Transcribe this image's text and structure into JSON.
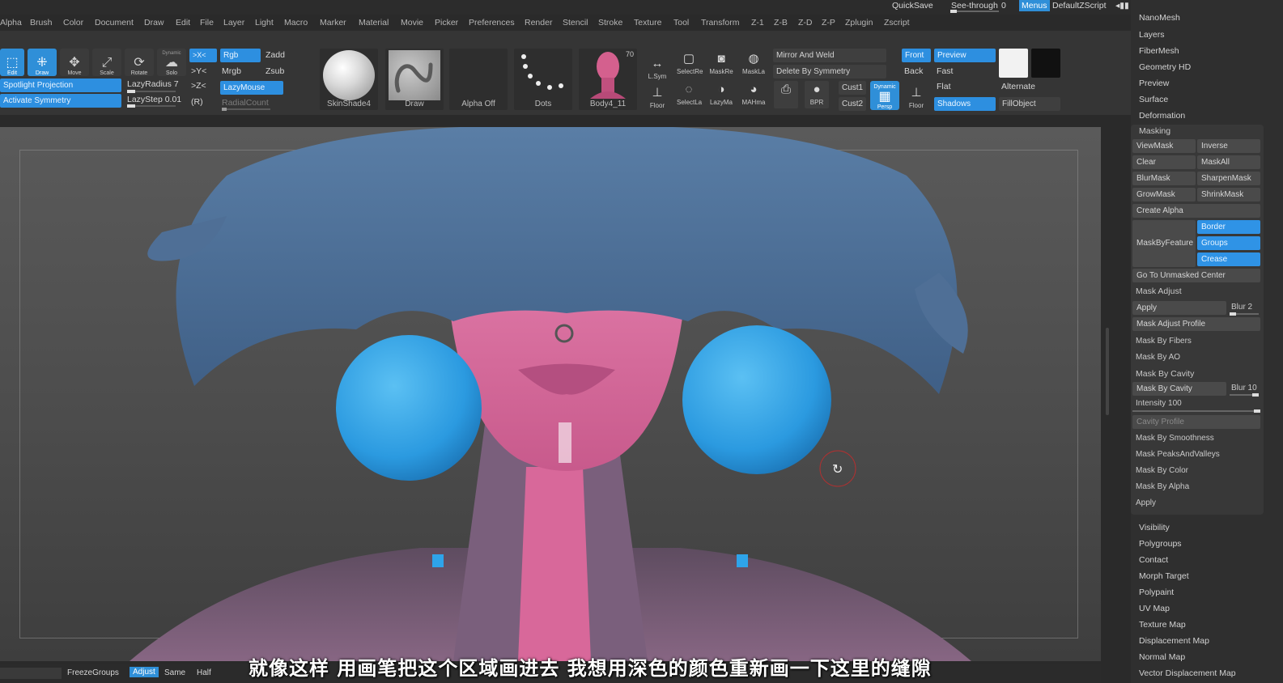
{
  "menubar": {
    "items": [
      "Alpha",
      "Brush",
      "Color",
      "Document",
      "Draw",
      "Edit",
      "File",
      "Layer",
      "Light",
      "Macro",
      "Marker",
      "Material",
      "Movie",
      "Picker",
      "Preferences",
      "Render",
      "Stencil",
      "Stroke",
      "Texture",
      "Tool",
      "Transform",
      "Z-1",
      "Z-B",
      "Z-D",
      "Z-P",
      "Zplugin",
      "Zscript"
    ],
    "quicksave": "QuickSave",
    "see_through_label": "See-through",
    "see_through_value": "0",
    "menus_label": "Menus",
    "default_script": "DefaultZScript"
  },
  "shelf": {
    "edit": "Edit",
    "draw": "Draw",
    "move": "Move",
    "scale": "Scale",
    "rotate": "Rotate",
    "dynamic": "Dynamic",
    "solo": "Solo",
    "spotlight": "Spotlight Projection",
    "activate_symmetry": "Activate Symmetry",
    "lazy_radius": "LazyRadius 7",
    "lazy_step": "LazyStep 0.01",
    "x_axis": ">X<",
    "y_axis": ">Y<",
    "z_axis": ">Z<",
    "r_axis": "(R)",
    "rgb": "Rgb",
    "mrgb": "Mrgb",
    "lazymouse": "LazyMouse",
    "radialcount": "RadialCount",
    "zadd": "Zadd",
    "zsub": "Zsub",
    "material": "SkinShade4",
    "brush": "Draw",
    "alpha": "Alpha Off",
    "stroke": "Dots",
    "tool": "Body4_11",
    "tool_count": "70",
    "lsym": "L.Sym",
    "floor": "Floor",
    "select_rect": "SelectRe",
    "mask_rect": "MaskRe",
    "mask_lasso": "MaskLa",
    "select_lasso": "SelectLa",
    "lazy_mask": "LazyMa",
    "mah_mask": "MAHma",
    "bpr": "BPR",
    "mirror_weld": "Mirror And Weld",
    "delete_symmetry": "Delete By Symmetry",
    "cust1": "Cust1",
    "cust2": "Cust2",
    "dynamic_persp": "Dynamic",
    "persp": "Persp",
    "front": "Front",
    "back": "Back",
    "floor2": "Floor",
    "preview": "Preview",
    "fast": "Fast",
    "flat": "Flat",
    "shadows": "Shadows",
    "alternate": "Alternate",
    "fillobject": "FillObject"
  },
  "palette": {
    "items_top": [
      "NanoMesh",
      "Layers",
      "FiberMesh",
      "Geometry HD",
      "Preview",
      "Surface",
      "Deformation"
    ],
    "masking_title": "Masking",
    "viewmask": "ViewMask",
    "inverse": "Inverse",
    "clear": "Clear",
    "maskall": "MaskAll",
    "blurmask": "BlurMask",
    "sharpenmask": "SharpenMask",
    "growmask": "GrowMask",
    "shrinkmask": "ShrinkMask",
    "create_alpha": "Create Alpha",
    "mask_by_feature": "MaskByFeature",
    "border": "Border",
    "groups": "Groups",
    "crease": "Crease",
    "go_unmasked": "Go To Unmasked Center",
    "mask_adjust": "Mask Adjust",
    "apply1": "Apply",
    "blur2": "Blur 2",
    "mask_adjust_profile": "Mask Adjust Profile",
    "mask_by_fibers": "Mask By Fibers",
    "mask_by_ao": "Mask By AO",
    "mask_by_cavity_section": "Mask By Cavity",
    "mask_by_cavity": "Mask By Cavity",
    "blur10": "Blur 10",
    "intensity": "Intensity 100",
    "cavity_profile": "Cavity Profile",
    "mask_by_smoothness": "Mask By Smoothness",
    "mask_peaks": "Mask PeaksAndValleys",
    "mask_by_color": "Mask By Color",
    "mask_by_alpha": "Mask By Alpha",
    "apply2": "Apply",
    "items_bottom": [
      "Visibility",
      "Polygroups",
      "Contact",
      "Morph Target",
      "Polypaint",
      "UV Map",
      "Texture Map",
      "Displacement Map",
      "Normal Map",
      "Vector Displacement Map"
    ]
  },
  "bottom": {
    "freezegroups": "FreezeGroups",
    "adjust": "Adjust",
    "same": "Same",
    "half": "Half"
  },
  "subtitle": "就像这样 用画笔把这个区域画进去 我想用深色的颜色重新画一下这里的缝隙",
  "colors": {
    "accent": "#2f93e6",
    "hair": "#4e6f95",
    "skin": "#d86a9c",
    "earrings": "#33a8e8",
    "suit": "#7a5a78"
  }
}
